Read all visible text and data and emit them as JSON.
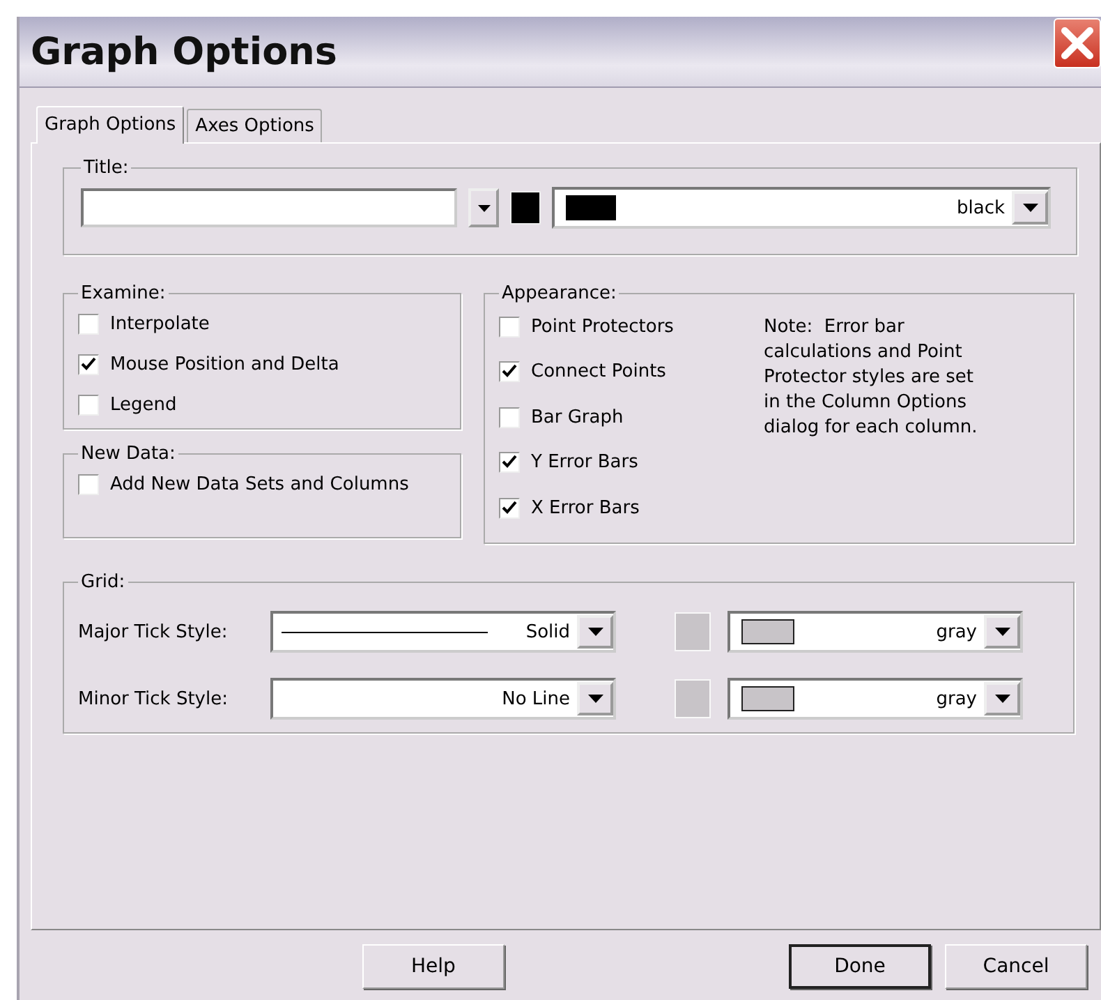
{
  "window": {
    "title": "Graph Options"
  },
  "tabs": [
    {
      "label": "Graph Options",
      "selected": true
    },
    {
      "label": "Axes Options",
      "selected": false
    }
  ],
  "title_group": {
    "legend": "Title:",
    "color": "#000000",
    "color_name": "black"
  },
  "examine": {
    "legend": "Examine:",
    "options": [
      {
        "label": "Interpolate",
        "checked": false
      },
      {
        "label": "Mouse Position and Delta",
        "checked": true
      },
      {
        "label": "Legend",
        "checked": false
      }
    ]
  },
  "new_data": {
    "legend": "New Data:",
    "options": [
      {
        "label": "Add New Data Sets and Columns",
        "checked": false
      }
    ]
  },
  "appearance": {
    "legend": "Appearance:",
    "options": [
      {
        "label": "Point Protectors",
        "checked": false
      },
      {
        "label": "Connect Points",
        "checked": true
      },
      {
        "label": "Bar Graph",
        "checked": false
      },
      {
        "label": "Y Error Bars",
        "checked": true
      },
      {
        "label": "X Error Bars",
        "checked": true
      }
    ],
    "note": "Note:  Error bar calculations and Point Protector styles are set in the Column Options dialog for each column."
  },
  "grid": {
    "legend": "Grid:",
    "rows": [
      {
        "label": "Major Tick Style:",
        "style": "Solid",
        "kind": "solid",
        "color": "#c8c4c8",
        "color_name": "gray"
      },
      {
        "label": "Minor Tick Style:",
        "style": "No Line",
        "kind": "none",
        "color": "#c8c4c8",
        "color_name": "gray"
      }
    ]
  },
  "buttons": [
    {
      "label": "Help",
      "default": false
    },
    {
      "label": "Done",
      "default": true
    },
    {
      "label": "Cancel",
      "default": false
    }
  ]
}
